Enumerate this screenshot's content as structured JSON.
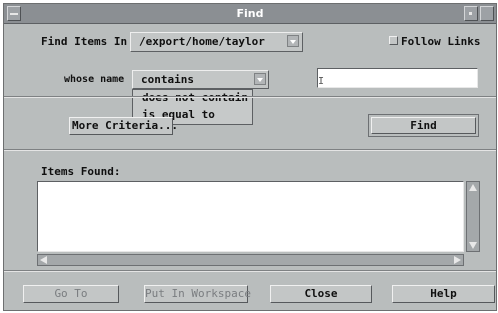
{
  "window": {
    "title": "Find"
  },
  "search": {
    "find_items_label": "Find Items In",
    "folder_value": "/export/home/taylor",
    "follow_links_label": "Follow Links",
    "whose_name_label": "whose name",
    "criteria_selected": "contains",
    "criteria_options": [
      "contains",
      "does not contain",
      "is equal to"
    ],
    "name_value": ""
  },
  "actions": {
    "more_criteria_label": "More Criteria...",
    "find_label": "Find"
  },
  "results": {
    "items_found_label": "Items Found:",
    "items": []
  },
  "footer": {
    "go_to_label": "Go To",
    "put_in_workspace_label": "Put In Workspace",
    "close_label": "Close",
    "help_label": "Help"
  },
  "icons": {
    "window_menu": "window-menu-icon",
    "minimize": "minimize-icon",
    "maximize": "maximize-icon",
    "combo_arrow": "chevron-down-icon"
  }
}
